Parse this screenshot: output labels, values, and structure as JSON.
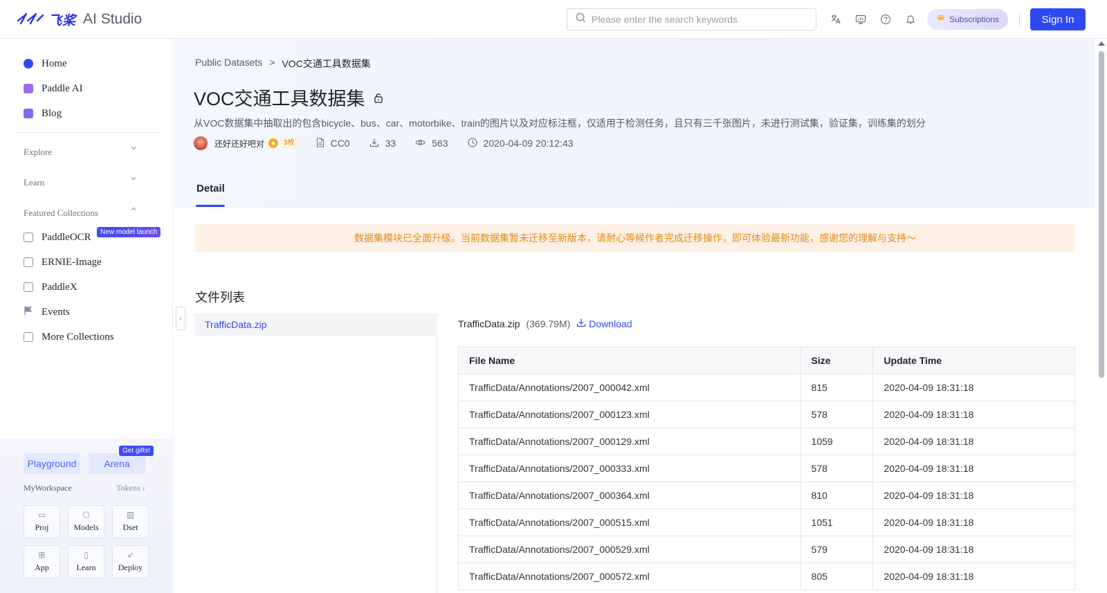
{
  "header": {
    "logo_cn": "飞桨",
    "logo_text": "AI Studio",
    "search_placeholder": "Please enter the search keywords",
    "subscriptions_label": "Subscriptions",
    "signin_label": "Sign In",
    "icons": [
      "translate-icon",
      "monitor-icon",
      "help-icon",
      "bell-icon"
    ]
  },
  "sidebar": {
    "items": [
      {
        "label": "Home",
        "icon": "home-icon",
        "color": "#2f49f2"
      },
      {
        "label": "Paddle AI",
        "icon": "paddle-ai-icon",
        "color": "#9b6cf2"
      },
      {
        "label": "Blog",
        "icon": "blog-icon",
        "color": "#7a6cf2"
      }
    ],
    "sections": [
      "Explore",
      "Learn",
      "Featured Collections"
    ],
    "collections": [
      {
        "label": "PaddleOCR",
        "badge": "New model launch"
      },
      {
        "label": "ERNIE-Image"
      },
      {
        "label": "PaddleX"
      },
      {
        "label": "Events"
      },
      {
        "label": "More Collections"
      }
    ],
    "playground_label": "Playground",
    "arena_label": "Arena",
    "gift_badge": "Get gifts!",
    "workspace_label": "MyWorkspace",
    "tokens_label": "Tokens",
    "tiles": [
      "Proj",
      "Models",
      "Dset",
      "App",
      "Learn",
      "Deploy"
    ]
  },
  "page": {
    "breadcrumb_root": "Public Datasets",
    "breadcrumb_sep": ">",
    "breadcrumb_current": "VOC交通工具数据集",
    "title": "VOC交通工具数据集",
    "description": "从VOC数据集中抽取出的包含bicycle、bus、car、motorbike、train的图片以及对应标注框，仅适用于检测任务，且只有三千张图片，未进行测试集，验证集，训练集的划分",
    "author": "还好还好吧对",
    "fans_badge": "3枚",
    "license": "CC0",
    "downloads": "33",
    "views": "563",
    "created": "2020-04-09 20:12:43",
    "tab_detail": "Detail",
    "notice": "数据集模块已全面升级。当前数据集暂未迁移至新版本，请耐心等候作者完成迁移操作，即可体验最新功能，感谢您的理解与支持～",
    "file_list_title": "文件列表",
    "files": [
      "TrafficData.zip"
    ],
    "selected_file": {
      "name": "TrafficData.zip",
      "size": "(369.79M)",
      "download_label": "Download"
    },
    "table": {
      "headers": [
        "File Name",
        "Size",
        "Update Time"
      ],
      "rows": [
        [
          "TrafficData/Annotations/2007_000042.xml",
          "815",
          "2020-04-09 18:31:18"
        ],
        [
          "TrafficData/Annotations/2007_000123.xml",
          "578",
          "2020-04-09 18:31:18"
        ],
        [
          "TrafficData/Annotations/2007_000129.xml",
          "1059",
          "2020-04-09 18:31:18"
        ],
        [
          "TrafficData/Annotations/2007_000333.xml",
          "578",
          "2020-04-09 18:31:18"
        ],
        [
          "TrafficData/Annotations/2007_000364.xml",
          "810",
          "2020-04-09 18:31:18"
        ],
        [
          "TrafficData/Annotations/2007_000515.xml",
          "1051",
          "2020-04-09 18:31:18"
        ],
        [
          "TrafficData/Annotations/2007_000529.xml",
          "579",
          "2020-04-09 18:31:18"
        ],
        [
          "TrafficData/Annotations/2007_000572.xml",
          "805",
          "2020-04-09 18:31:18"
        ]
      ]
    }
  }
}
